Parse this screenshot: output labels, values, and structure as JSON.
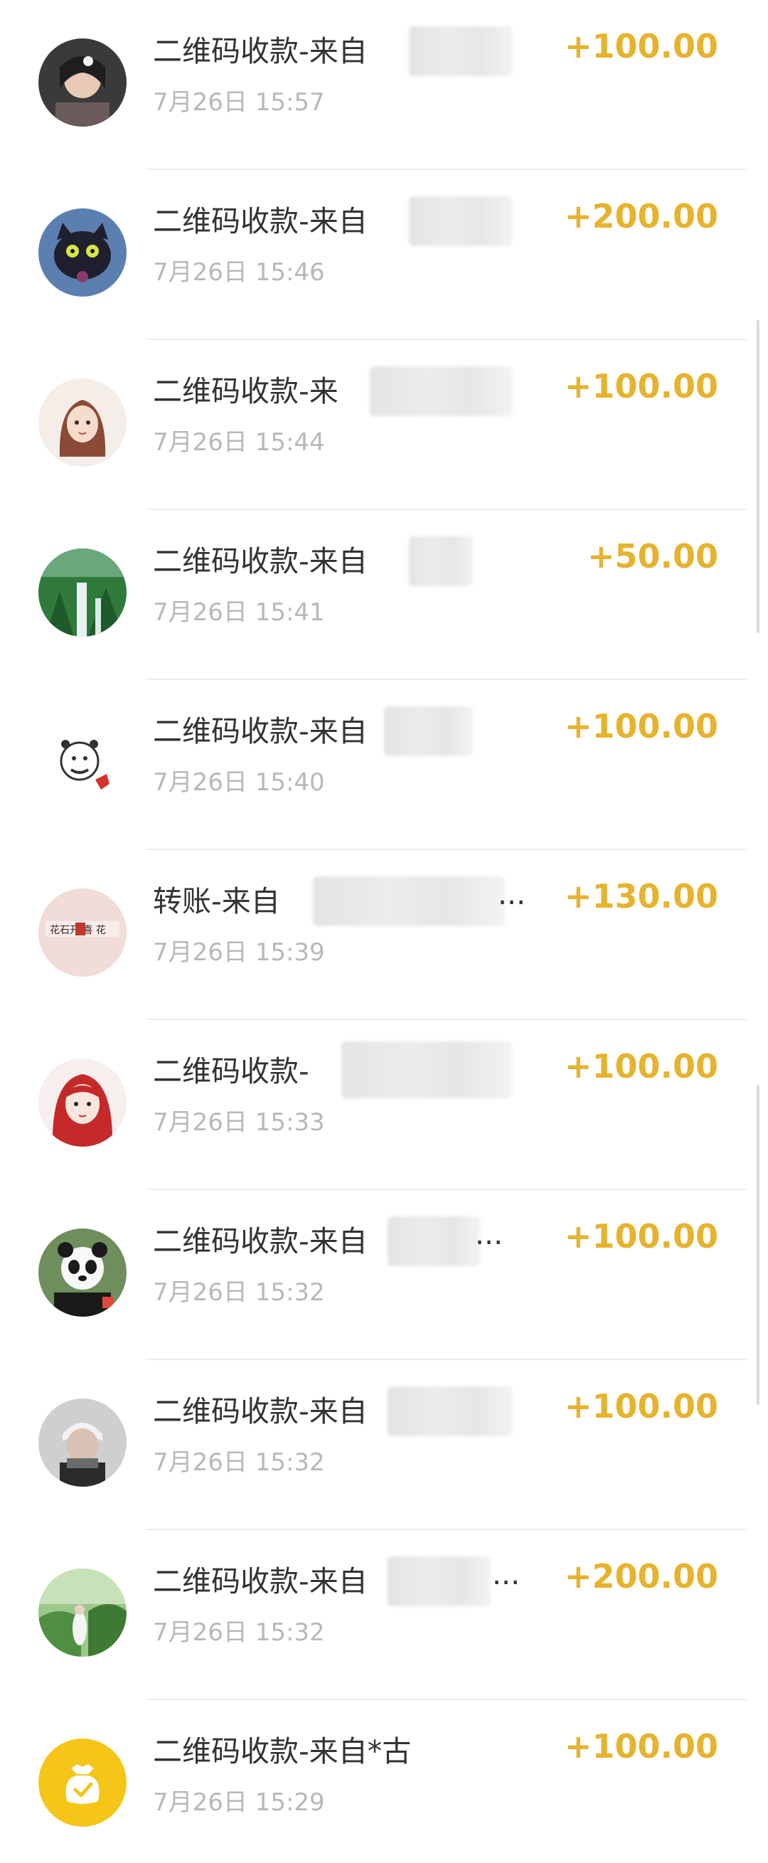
{
  "accent_color": "#e6b32e",
  "transactions": [
    {
      "title": "二维码收款-来自",
      "time": "7月26日 15:57",
      "amount": "+100.00",
      "avatar": "girl-photo-avatar"
    },
    {
      "title": "二维码收款-来自",
      "time": "7月26日 15:46",
      "amount": "+200.00",
      "avatar": "cat-avatar"
    },
    {
      "title": "二维码收款-来",
      "time": "7月26日 15:44",
      "amount": "+100.00",
      "avatar": "anime-girl-avatar"
    },
    {
      "title": "二维码收款-来自",
      "time": "7月26日 15:41",
      "amount": "+50.00",
      "avatar": "waterfall-avatar"
    },
    {
      "title": "二维码收款-来自",
      "time": "7月26日 15:40",
      "amount": "+100.00",
      "avatar": "cartoon-face-avatar"
    },
    {
      "title": "转账-来自",
      "time": "7月26日 15:39",
      "amount": "+130.00",
      "avatar": "calligraphy-avatar"
    },
    {
      "title": "二维码收款-",
      "time": "7月26日 15:33",
      "amount": "+100.00",
      "avatar": "red-hair-girl-avatar"
    },
    {
      "title": "二维码收款-来自",
      "time": "7月26日 15:32",
      "amount": "+100.00",
      "avatar": "panda-avatar"
    },
    {
      "title": "二维码收款-来自",
      "time": "7月26日 15:32",
      "amount": "+100.00",
      "avatar": "boy-photo-avatar"
    },
    {
      "title": "二维码收款-来自",
      "time": "7月26日 15:32",
      "amount": "+200.00",
      "avatar": "garden-avatar"
    },
    {
      "title": "二维码收款-来自*古",
      "time": "7月26日 15:29",
      "amount": "+100.00",
      "avatar": "money-bag-icon"
    }
  ],
  "ellipsis": "..."
}
